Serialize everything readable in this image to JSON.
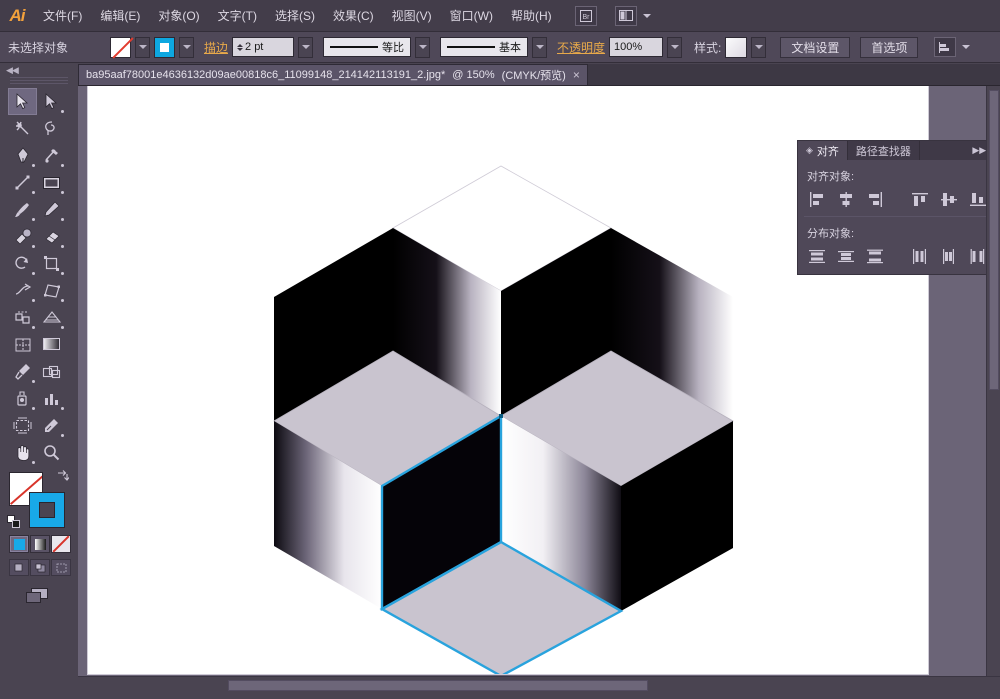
{
  "app": {
    "name": "Ai",
    "logo_color": "#f3a13c"
  },
  "menubar": {
    "items": [
      {
        "label": "文件(F)",
        "name": "menu-file"
      },
      {
        "label": "编辑(E)",
        "name": "menu-edit"
      },
      {
        "label": "对象(O)",
        "name": "menu-object"
      },
      {
        "label": "文字(T)",
        "name": "menu-type"
      },
      {
        "label": "选择(S)",
        "name": "menu-select"
      },
      {
        "label": "效果(C)",
        "name": "menu-effect"
      },
      {
        "label": "视图(V)",
        "name": "menu-view"
      },
      {
        "label": "窗口(W)",
        "name": "menu-window"
      },
      {
        "label": "帮助(H)",
        "name": "menu-help"
      }
    ],
    "bridge_icon": "bridge-icon",
    "arrange_icon": "arrange-documents-icon"
  },
  "controlbar": {
    "selection_status": "未选择对象",
    "fill_swatch": "none",
    "stroke_swatch_color": "#0da7e0",
    "stroke_label": "描边",
    "stroke_weight": "2 pt",
    "stroke_profile": "等比",
    "brush_definition": "基本",
    "opacity_label": "不透明度",
    "opacity_value": "100%",
    "style_label": "样式:",
    "document_setup": "文档设置",
    "preferences": "首选项"
  },
  "tabbar": {
    "tab_title": "ba95aaf78001e4636132d09ae00818c6_11099148_214142113191_2.jpg*",
    "tab_zoom": "@ 150%",
    "tab_mode": "(CMYK/预览)",
    "close_glyph": "×"
  },
  "toolbox": {
    "tools": [
      {
        "name": "selection-tool",
        "selected": true
      },
      {
        "name": "direct-selection-tool",
        "selected": false
      },
      {
        "name": "magic-wand-tool",
        "selected": false
      },
      {
        "name": "lasso-tool",
        "selected": false
      },
      {
        "name": "pen-tool",
        "selected": false
      },
      {
        "name": "add-anchor-point-tool",
        "selected": false
      },
      {
        "name": "line-segment-tool",
        "selected": false
      },
      {
        "name": "rectangle-tool",
        "selected": false
      },
      {
        "name": "paintbrush-tool",
        "selected": false
      },
      {
        "name": "pencil-tool",
        "selected": false
      },
      {
        "name": "blob-brush-tool",
        "selected": false
      },
      {
        "name": "eraser-tool",
        "selected": false
      },
      {
        "name": "rotate-tool",
        "selected": false
      },
      {
        "name": "scale-tool",
        "selected": false
      },
      {
        "name": "width-tool",
        "selected": false
      },
      {
        "name": "free-transform-tool",
        "selected": false
      },
      {
        "name": "shape-builder-tool",
        "selected": false
      },
      {
        "name": "perspective-grid-tool",
        "selected": false
      },
      {
        "name": "mesh-tool",
        "selected": false
      },
      {
        "name": "gradient-tool",
        "selected": false
      },
      {
        "name": "eyedropper-tool",
        "selected": false
      },
      {
        "name": "blend-tool",
        "selected": false
      },
      {
        "name": "symbol-sprayer-tool",
        "selected": false
      },
      {
        "name": "column-graph-tool",
        "selected": false
      },
      {
        "name": "artboard-tool",
        "selected": false
      },
      {
        "name": "slice-tool",
        "selected": false
      },
      {
        "name": "hand-tool",
        "selected": false
      },
      {
        "name": "zoom-tool",
        "selected": false
      }
    ],
    "fill_color": "none",
    "stroke_color": "#18a9e8",
    "color_modes": [
      "color-mode-solid",
      "color-mode-gradient",
      "color-mode-none"
    ],
    "active_color_mode": "color-mode-solid",
    "draw_modes": [
      "draw-normal",
      "draw-behind",
      "draw-inside"
    ],
    "screen_mode": "change-screen-mode"
  },
  "panel": {
    "tabs": [
      {
        "label": "对齐",
        "name": "tab-align",
        "active": true
      },
      {
        "label": "路径查找器",
        "name": "tab-pathfinder",
        "active": false
      }
    ],
    "align_section_title": "对齐对象:",
    "distribute_section_title": "分布对象:",
    "align_buttons": [
      "align-left-icon",
      "align-horizontal-center-icon",
      "align-right-icon",
      "align-top-icon",
      "align-vertical-center-icon",
      "align-bottom-icon"
    ],
    "distribute_buttons": [
      "distribute-top-icon",
      "distribute-vertical-center-icon",
      "distribute-bottom-icon",
      "distribute-left-icon",
      "distribute-horizontal-center-icon",
      "distribute-right-icon"
    ],
    "collapse_icon": "double-arrow-right-icon",
    "menu_icon": "panel-menu-icon"
  },
  "artwork": {
    "description": "isometric-cube-illusion",
    "selection_color": "#29a3dd",
    "top_face_color": "#c9c4cf",
    "dark_face_color": "#050308",
    "white_bg": "#ffffff"
  }
}
